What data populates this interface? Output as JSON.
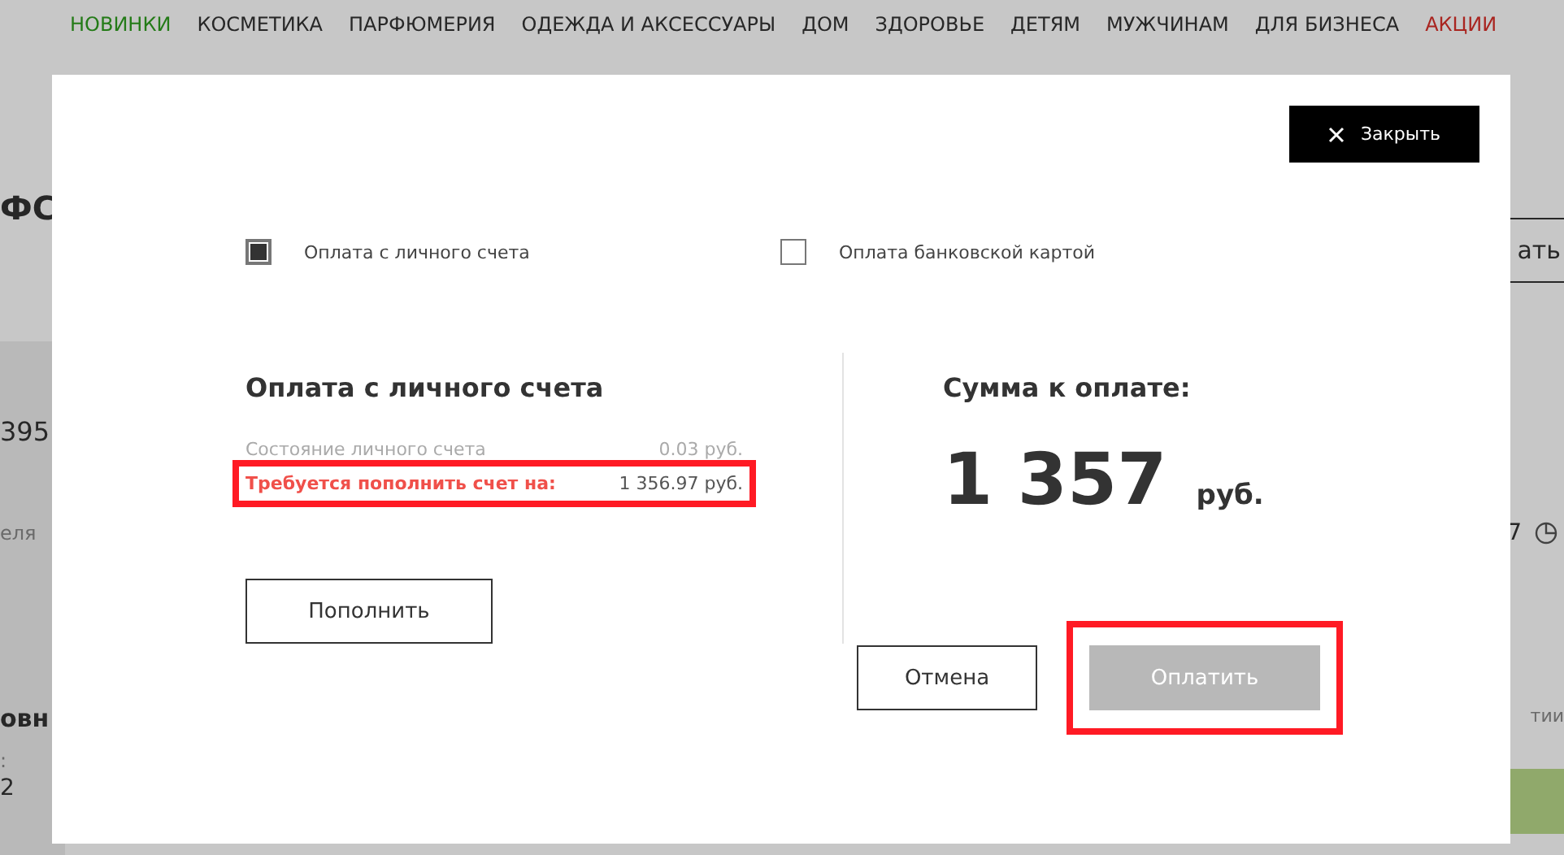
{
  "nav": [
    {
      "label": "НОВИНКИ",
      "kind": "new"
    },
    {
      "label": "КОСМЕТИКА",
      "kind": "plain"
    },
    {
      "label": "ПАРФЮМЕРИЯ",
      "kind": "plain"
    },
    {
      "label": "ОДЕЖДА И АКСЕССУАРЫ",
      "kind": "plain"
    },
    {
      "label": "ДОМ",
      "kind": "plain"
    },
    {
      "label": "ЗДОРОВЬЕ",
      "kind": "plain"
    },
    {
      "label": "ДЕТЯМ",
      "kind": "plain"
    },
    {
      "label": "МУЖЧИНАМ",
      "kind": "plain"
    },
    {
      "label": "ДЛЯ БИЗНЕСА",
      "kind": "plain"
    },
    {
      "label": "АКЦИИ",
      "kind": "sale"
    }
  ],
  "background": {
    "heading": "ФС",
    "number": "395",
    "caption": "еля",
    "subheading": "овн",
    "colon": ":",
    "digit": "2",
    "link": "ать",
    "count": "7",
    "note": "тии"
  },
  "modal": {
    "close_button": "Закрыть",
    "payment_options": [
      {
        "label": "Оплата с личного счета",
        "selected": true
      },
      {
        "label": "Оплата банковской картой",
        "selected": false
      }
    ],
    "account": {
      "title": "Оплата с личного счета",
      "rows": [
        {
          "label": "Состояние личного счета",
          "value": "0.03 руб.",
          "kind": "normal",
          "highlighted": false
        },
        {
          "label": "Требуется пополнить счет на:",
          "value": "1 356.97 руб.",
          "kind": "alert",
          "highlighted": true
        }
      ]
    },
    "topup_button": "Пополнить",
    "total": {
      "title": "Сумма к оплате:",
      "amount": "1 357",
      "currency": "руб."
    },
    "cancel_button": "Отмена",
    "pay_button": {
      "label": "Оплатить",
      "disabled": true,
      "highlighted": true
    }
  }
}
